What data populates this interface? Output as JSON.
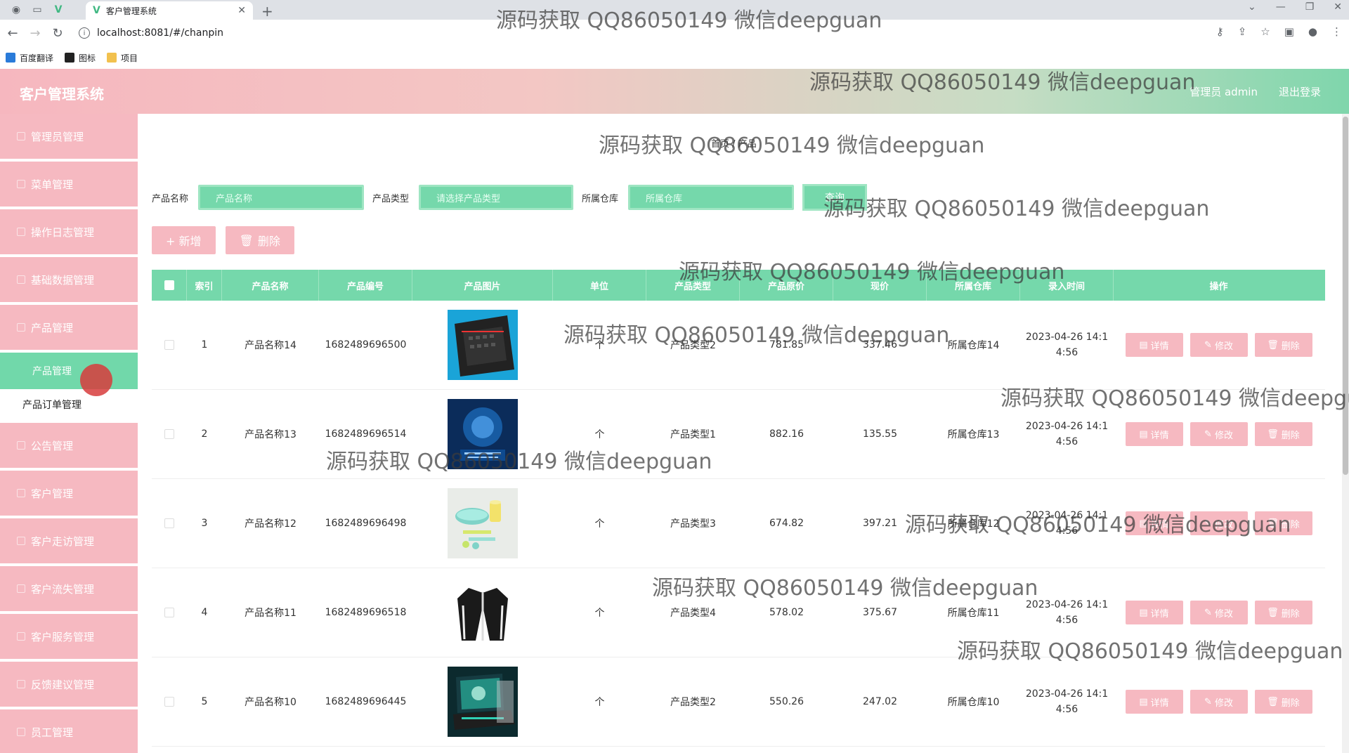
{
  "browser": {
    "tab_title": "客户管理系统",
    "url": "localhost:8081/#/chanpin",
    "bookmarks": [
      "百度翻译",
      "图标",
      "项目"
    ]
  },
  "header": {
    "app_title": "客户管理系统",
    "user": "管理员 admin",
    "logout": "退出登录"
  },
  "sidebar": {
    "items_top": [
      "管理员管理",
      "菜单管理",
      "操作日志管理",
      "基础数据管理",
      "产品管理"
    ],
    "active_sub": "产品管理",
    "sub_item": "产品订单管理",
    "items_bottom": [
      "公告管理",
      "客户管理",
      "客户走访管理",
      "客户流失管理",
      "客户服务管理",
      "反馈建议管理",
      "员工管理"
    ]
  },
  "breadcrumb": "首页 / 产品",
  "filters": {
    "name_label": "产品名称",
    "name_placeholder": "产品名称",
    "type_label": "产品类型",
    "type_placeholder": "请选择产品类型",
    "warehouse_label": "所属仓库",
    "warehouse_placeholder": "所属仓库",
    "search": "查询"
  },
  "actions": {
    "add": "+ 新增",
    "delete": "删除"
  },
  "table": {
    "headers": [
      "索引",
      "产品名称",
      "产品编号",
      "产品图片",
      "单位",
      "产品类型",
      "产品原价",
      "现价",
      "所属仓库",
      "录入时间",
      "操作"
    ],
    "op_labels": {
      "detail": "详情",
      "edit": "修改",
      "delete": "删除"
    },
    "rows": [
      {
        "idx": "1",
        "name": "产品名称14",
        "code": "1682489696500",
        "unit": "个",
        "type": "产品类型2",
        "orig": "781.85",
        "price": "337.46",
        "warehouse": "所属仓库14",
        "time1": "2023-04-26 14:1",
        "time2": "4:56",
        "img": "laptop-keyboard"
      },
      {
        "idx": "2",
        "name": "产品名称13",
        "code": "1682489696514",
        "unit": "个",
        "type": "产品类型1",
        "orig": "882.16",
        "price": "135.55",
        "warehouse": "所属仓库13",
        "time1": "2023-04-26 14:1",
        "time2": "4:56",
        "img": "blue-book"
      },
      {
        "idx": "3",
        "name": "产品名称12",
        "code": "1682489696498",
        "unit": "个",
        "type": "产品类型3",
        "orig": "674.82",
        "price": "397.21",
        "warehouse": "所属仓库12",
        "time1": "2023-04-26 14:1",
        "time2": "4:56",
        "img": "bowls"
      },
      {
        "idx": "4",
        "name": "产品名称11",
        "code": "1682489696518",
        "unit": "个",
        "type": "产品类型4",
        "orig": "578.02",
        "price": "375.67",
        "warehouse": "所属仓库11",
        "time1": "2023-04-26 14:1",
        "time2": "4:56",
        "img": "jacket"
      },
      {
        "idx": "5",
        "name": "产品名称10",
        "code": "1682489696445",
        "unit": "个",
        "type": "产品类型2",
        "orig": "550.26",
        "price": "247.02",
        "warehouse": "所属仓库10",
        "time1": "2023-04-26 14:1",
        "time2": "4:56",
        "img": "gaming-laptop"
      }
    ]
  },
  "watermark": "源码获取 QQ86050149 微信deepguan"
}
